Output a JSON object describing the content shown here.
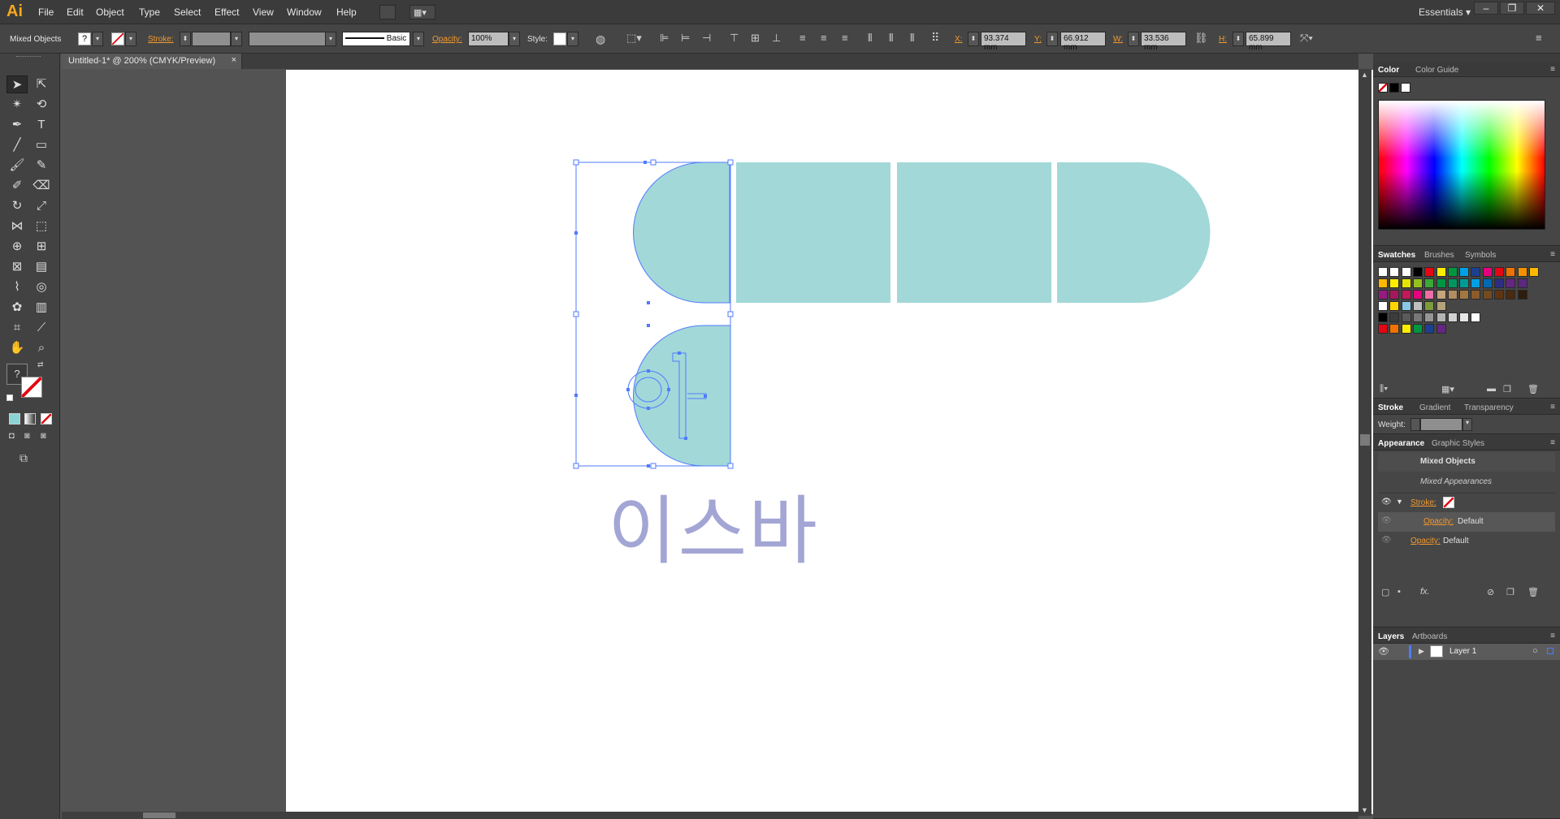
{
  "app": {
    "logo": "Ai",
    "workspace": "Essentials",
    "menus": [
      "File",
      "Edit",
      "Object",
      "Type",
      "Select",
      "Effect",
      "View",
      "Window",
      "Help"
    ]
  },
  "control_bar": {
    "selection_type": "Mixed Objects",
    "fill_glyph": "?",
    "stroke_label": "Stroke:",
    "brush_style": "Basic",
    "opacity_label": "Opacity:",
    "opacity_value": "100%",
    "style_label": "Style:",
    "x_label": "X:",
    "x_value": "93.374 mm",
    "y_label": "Y:",
    "y_value": "66.912 mm",
    "w_label": "W:",
    "w_value": "33.536 mm",
    "h_label": "H:",
    "h_value": "65.899 mm"
  },
  "document": {
    "tab_title": "Untitled-1* @ 200% (CMYK/Preview)",
    "close_glyph": "×"
  },
  "artwork": {
    "shape_fill": "#a2d8d8",
    "selection_color": "#4f7bff",
    "text": "이스바",
    "text_color": "#a3a6d4",
    "glyph_in_shape": "이"
  },
  "panels": {
    "color": {
      "tabs": [
        "Color",
        "Color Guide"
      ]
    },
    "swatches": {
      "tabs": [
        "Swatches",
        "Brushes",
        "Symbols"
      ],
      "rows": [
        [
          "#ffffff",
          "#ffffff",
          "#ffffff",
          "#000000",
          "#e30613",
          "#ffed00",
          "#009640",
          "#00a0e3",
          "#1d3f8f",
          "#e5007d",
          "#e30613",
          "#ee7203",
          "#f39200",
          "#fbb800"
        ],
        [
          "#fbb800",
          "#ffed00",
          "#e3e500",
          "#95c11f",
          "#3aaa35",
          "#009640",
          "#00965e",
          "#009b95",
          "#009fe3",
          "#0069b4",
          "#2d2e83",
          "#662483",
          "#5a287e"
        ],
        [
          "#951b81",
          "#a3195b",
          "#c2185b",
          "#e4007d",
          "#ec6ea6",
          "#c4a57a",
          "#b18d62",
          "#a27740",
          "#8b5b2a",
          "#744a1f",
          "#5e3413",
          "#4a2a11",
          "#2d1d0d"
        ],
        [
          "#ffffff",
          "#ffd400",
          "#8ac8e8",
          "#bfbfbf",
          "#7d9b3a",
          "#b5a27a"
        ],
        [
          "#000000",
          "#3c3c3c",
          "#5a5a5a",
          "#787878",
          "#969696",
          "#b4b4b4",
          "#d2d2d2",
          "#e6e6e6",
          "#ffffff"
        ],
        [
          "#e30613",
          "#ee7203",
          "#ffed00",
          "#009640",
          "#1d3f8f",
          "#662483"
        ]
      ]
    },
    "stroke": {
      "tabs": [
        "Stroke",
        "Gradient",
        "Transparency"
      ],
      "weight_label": "Weight:"
    },
    "appearance": {
      "tabs": [
        "Appearance",
        "Graphic Styles"
      ],
      "title": "Mixed Objects",
      "subtitle": "Mixed Appearances",
      "stroke_label": "Stroke:",
      "opacity_label": "Opacity:",
      "opacity_value": "Default",
      "opacity2_label": "Opacity:",
      "opacity2_value": "Default",
      "fx": "fx."
    },
    "layers": {
      "tabs": [
        "Layers",
        "Artboards"
      ],
      "layer_name": "Layer 1"
    }
  }
}
